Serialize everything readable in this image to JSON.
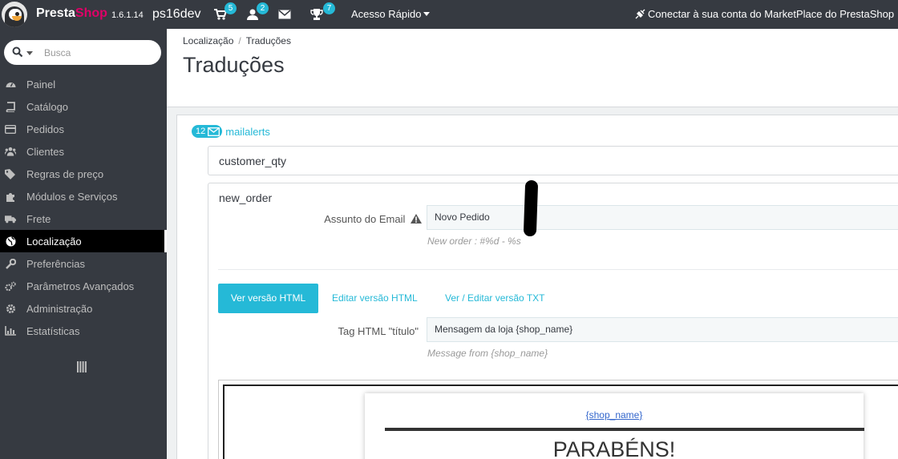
{
  "header": {
    "brand_presta": "Presta",
    "brand_shop": "Shop",
    "version": "1.6.1.14",
    "shop_name": "ps16dev",
    "badges": {
      "orders": "5",
      "customers": "2",
      "messages": "7"
    },
    "quick_access": "Acesso Rápido",
    "marketplace": "Conectar à sua conta do MarketPlace do PrestaShop"
  },
  "sidebar": {
    "search_placeholder": "Busca",
    "items": [
      {
        "label": "Painel",
        "icon": "dashboard-icon"
      },
      {
        "label": "Catálogo",
        "icon": "book-icon"
      },
      {
        "label": "Pedidos",
        "icon": "credit-card-icon"
      },
      {
        "label": "Clientes",
        "icon": "users-icon"
      },
      {
        "label": "Regras de preço",
        "icon": "tags-icon"
      },
      {
        "label": "Módulos e Serviços",
        "icon": "puzzle-icon"
      },
      {
        "label": "Frete",
        "icon": "truck-icon"
      },
      {
        "label": "Localização",
        "icon": "globe-icon",
        "active": true
      },
      {
        "label": "Preferências",
        "icon": "wrench-icon"
      },
      {
        "label": "Parâmetros Avançados",
        "icon": "cogs-icon"
      },
      {
        "label": "Administração",
        "icon": "gear-icon"
      },
      {
        "label": "Estatísticas",
        "icon": "bar-chart-icon"
      }
    ]
  },
  "page": {
    "breadcrumb": [
      "Localização",
      "Traduções"
    ],
    "title": "Traduções"
  },
  "translations": {
    "module_count": "12",
    "module_name": "mailalerts",
    "templates": [
      "customer_qty",
      "new_order"
    ],
    "subject_label": "Assunto do Email",
    "subject_value": "Novo Pedido",
    "subject_help": "New order : #%d - %s",
    "tabs": [
      "Ver versão HTML",
      "Editar versão HTML",
      "Ver / Editar versão TXT"
    ],
    "title_tag_label": "Tag HTML \"título\"",
    "title_tag_value": "Mensagem da loja {shop_name}",
    "title_tag_help": "Message from {shop_name}"
  },
  "email_preview": {
    "shop_link": "{shop_name}",
    "heading": "PARABÉNS!"
  },
  "colors": {
    "accent": "#25b9d7",
    "topbar": "#363a41",
    "brand_pink": "#df0067"
  }
}
